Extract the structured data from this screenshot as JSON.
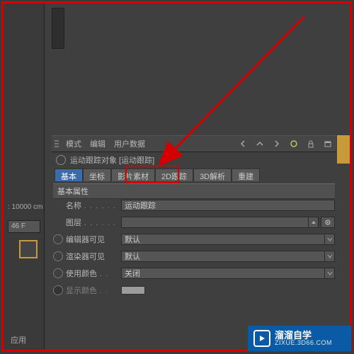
{
  "colors": {
    "accent": "#3d6aa8",
    "highlight": "#d40000",
    "brand": "#0b5aa5"
  },
  "left": {
    "info": ": 10000 cm",
    "frame": "46 F",
    "app_btn": "应用"
  },
  "toolbar": {
    "menu_mode": "模式",
    "menu_edit": "编辑",
    "menu_user": "用户数据"
  },
  "object": {
    "title": "运动跟踪对象 [运动跟踪]"
  },
  "tabs": {
    "t0": "基本",
    "t1": "坐标",
    "t2": "影片素材",
    "t3": "2D跟踪",
    "t4": "3D解析",
    "t5": "重建"
  },
  "section": "基本属性",
  "props": {
    "name_label": "名称",
    "name_value": "运动跟踪",
    "layer_label": "图层",
    "layer_value": "",
    "editor_vis_label": "编辑器可见",
    "editor_vis_value": "默认",
    "render_vis_label": "渲染器可见",
    "render_vis_value": "默认",
    "use_color_label": "使用颜色",
    "use_color_value": "关闭",
    "display_color_label": "显示颜色"
  },
  "watermark": {
    "cn": "溜溜自学",
    "en": "ZIXUE.3D66.COM"
  }
}
